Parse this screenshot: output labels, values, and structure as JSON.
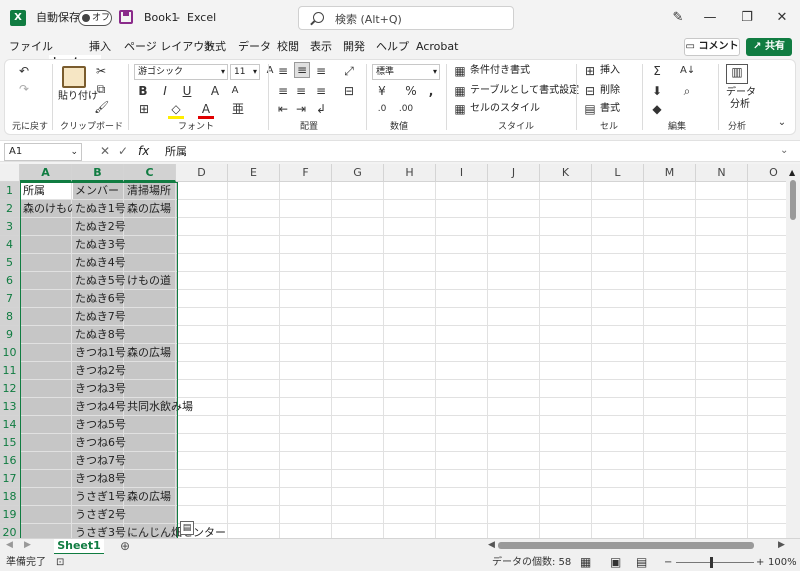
{
  "titlebar": {
    "autosave_label": "自動保存",
    "autosave_state": "オフ",
    "filename": "Book1",
    "separator": "-",
    "app": "Excel",
    "search_placeholder": "検索 (Alt+Q)"
  },
  "menu": {
    "items": [
      "ファイル",
      "ホーム",
      "挿入",
      "ページ レイアウト",
      "数式",
      "データ",
      "校閲",
      "表示",
      "開発",
      "ヘルプ",
      "Acrobat"
    ],
    "comment_label": "コメント",
    "share_label": "共有"
  },
  "ribbon": {
    "groups": [
      "元に戻す",
      "クリップボード",
      "フォント",
      "配置",
      "数値",
      "スタイル",
      "セル",
      "編集",
      "分析"
    ],
    "paste_label": "貼り付け",
    "font_name": "游ゴシック",
    "font_size": "11",
    "number_format": "標準",
    "conditional_format": "条件付き書式",
    "table_format": "テーブルとして書式設定",
    "cell_style": "セルのスタイル",
    "insert": "挿入",
    "delete": "削除",
    "format": "書式",
    "analyze_label1": "データ",
    "analyze_label2": "分析"
  },
  "formulabar": {
    "namebox": "A1",
    "fx": "fx",
    "formula": "所属"
  },
  "sheet": {
    "columns": [
      "A",
      "B",
      "C",
      "D",
      "E",
      "F",
      "G",
      "H",
      "I",
      "J",
      "K",
      "L",
      "M",
      "N",
      "O"
    ],
    "rows": [
      "1",
      "2",
      "3",
      "4",
      "5",
      "6",
      "7",
      "8",
      "9",
      "10",
      "11",
      "12",
      "13",
      "14",
      "15",
      "16",
      "17",
      "18",
      "19",
      "20"
    ],
    "cells": [
      [
        "所属",
        "メンバー",
        "清掃場所"
      ],
      [
        "森のけもの",
        "たぬき1号",
        "森の広場"
      ],
      [
        "",
        "たぬき2号",
        ""
      ],
      [
        "",
        "たぬき3号",
        ""
      ],
      [
        "",
        "たぬき4号",
        ""
      ],
      [
        "",
        "たぬき5号",
        "けもの道"
      ],
      [
        "",
        "たぬき6号",
        ""
      ],
      [
        "",
        "たぬき7号",
        ""
      ],
      [
        "",
        "たぬき8号",
        ""
      ],
      [
        "",
        "きつね1号",
        "森の広場"
      ],
      [
        "",
        "きつね2号",
        ""
      ],
      [
        "",
        "きつね3号",
        ""
      ],
      [
        "",
        "きつね4号",
        "共同水飲み場"
      ],
      [
        "",
        "きつね5号",
        ""
      ],
      [
        "",
        "きつね6号",
        ""
      ],
      [
        "",
        "きつね7号",
        ""
      ],
      [
        "",
        "きつね8号",
        ""
      ],
      [
        "",
        "うさぎ1号",
        "森の広場"
      ],
      [
        "",
        "うさぎ2号",
        ""
      ],
      [
        "",
        "うさぎ3号",
        "にんじん畑センター"
      ]
    ],
    "tab": "Sheet1"
  },
  "status": {
    "ready": "準備完了",
    "count": "データの個数: 58",
    "zoom": "100%"
  }
}
